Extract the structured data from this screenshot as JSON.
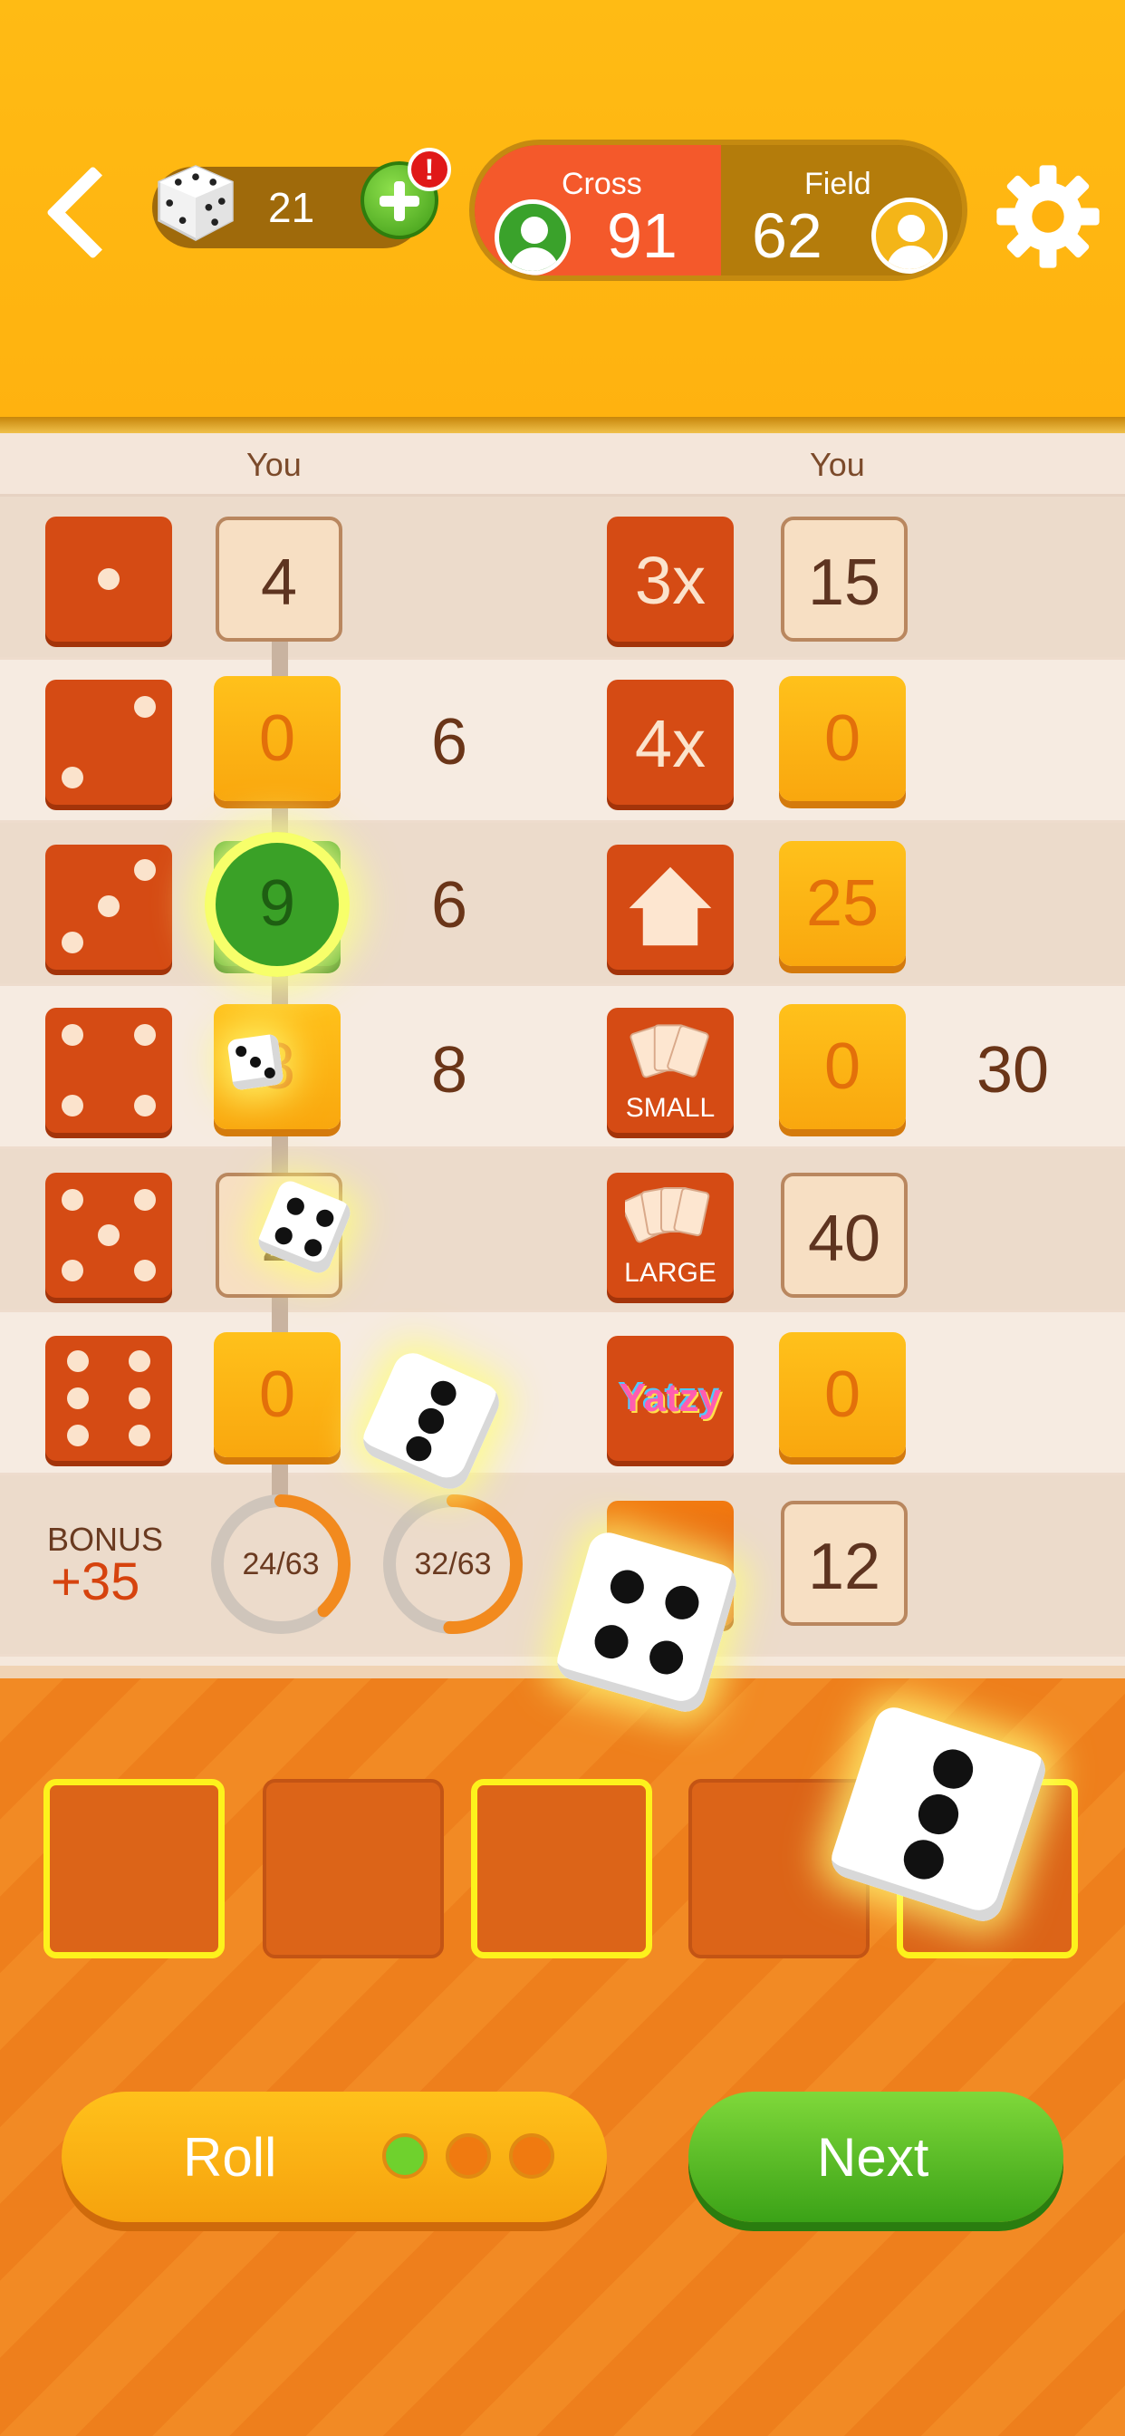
{
  "header": {
    "dice_count": "21",
    "alert_badge": "!",
    "left_player": {
      "name": "Cross",
      "score": "91",
      "color": "#f4592b"
    },
    "right_player": {
      "name": "Field",
      "score": "62",
      "color": "#b47c0b"
    }
  },
  "scoreboard": {
    "left_column_header": "You",
    "right_column_header": "You",
    "upper": [
      {
        "category": "ones",
        "score": "4",
        "state": "filled",
        "projection": ""
      },
      {
        "category": "twos",
        "score": "0",
        "state": "open",
        "projection": "6"
      },
      {
        "category": "threes",
        "score": "9",
        "state": "active",
        "projection": "6"
      },
      {
        "category": "fours",
        "score": "8",
        "state": "open",
        "projection": "8"
      },
      {
        "category": "fives",
        "score": "2",
        "state": "filled",
        "projection": ""
      },
      {
        "category": "sixes",
        "score": "0",
        "state": "open",
        "projection": ""
      }
    ],
    "lower": [
      {
        "category": "3x",
        "label": "3x",
        "score": "15",
        "state": "filled",
        "projection": ""
      },
      {
        "category": "4x",
        "label": "4x",
        "score": "0",
        "state": "open",
        "projection": ""
      },
      {
        "category": "full-house",
        "label": "",
        "score": "25",
        "state": "open",
        "projection": ""
      },
      {
        "category": "small-straight",
        "label": "SMALL",
        "score": "0",
        "state": "open",
        "projection": "30"
      },
      {
        "category": "large-straight",
        "label": "LARGE",
        "score": "40",
        "state": "filled",
        "projection": ""
      },
      {
        "category": "yatzy",
        "label": "Yatzy",
        "score": "0",
        "state": "open",
        "projection": ""
      },
      {
        "category": "chance",
        "label": "",
        "score": "12",
        "state": "filled",
        "projection": ""
      }
    ],
    "bonus_label": "BONUS",
    "bonus_value": "+35",
    "bonus_progress_left": {
      "text": "24/63",
      "value": 24,
      "max": 63
    },
    "bonus_progress_right": {
      "text": "32/63",
      "value": 32,
      "max": 63
    }
  },
  "buttons": {
    "roll_label": "Roll",
    "next_label": "Next",
    "rolls_left_indicator": [
      "#6fd12d",
      "#f07a10",
      "#f07a10"
    ]
  },
  "colors": {
    "board_orange": "#d54b14",
    "accent_yellow": "#ffb20f",
    "highlight_yellow": "#fdf21c"
  }
}
